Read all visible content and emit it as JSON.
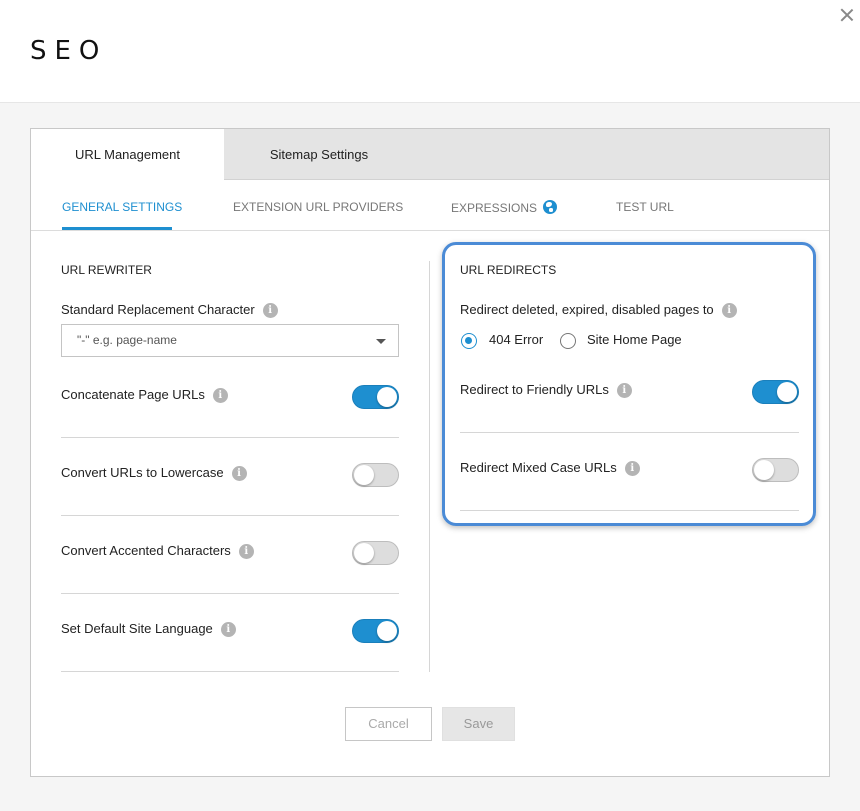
{
  "header": {
    "title": "SEO"
  },
  "top_tabs": [
    {
      "label": "URL Management",
      "active": true
    },
    {
      "label": "Sitemap Settings",
      "active": false
    }
  ],
  "sub_tabs": [
    {
      "label": "GENERAL SETTINGS",
      "active": true
    },
    {
      "label": "EXTENSION URL PROVIDERS",
      "active": false
    },
    {
      "label": "EXPRESSIONS",
      "active": false,
      "icon": "globe-icon"
    },
    {
      "label": "TEST URL",
      "active": false
    }
  ],
  "url_rewriter": {
    "title": "URL REWRITER",
    "replacement_char": {
      "label": "Standard Replacement Character",
      "value": "\"-\" e.g. page-name"
    },
    "settings": [
      {
        "label": "Concatenate Page URLs",
        "on": true
      },
      {
        "label": "Convert URLs to Lowercase",
        "on": false
      },
      {
        "label": "Convert Accented Characters",
        "on": false
      },
      {
        "label": "Set Default Site Language",
        "on": true
      }
    ]
  },
  "url_redirects": {
    "title": "URL REDIRECTS",
    "redirect_to": {
      "label": "Redirect deleted, expired, disabled pages to",
      "options": [
        "404 Error",
        "Site Home Page"
      ],
      "selected": "404 Error"
    },
    "settings": [
      {
        "label": "Redirect to Friendly URLs",
        "on": true
      },
      {
        "label": "Redirect Mixed Case URLs",
        "on": false
      }
    ]
  },
  "actions": {
    "cancel": "Cancel",
    "save": "Save"
  },
  "colors": {
    "accent": "#1e8fd0",
    "highlight_border": "#4b8bd6"
  },
  "info_icon_glyph": "i"
}
